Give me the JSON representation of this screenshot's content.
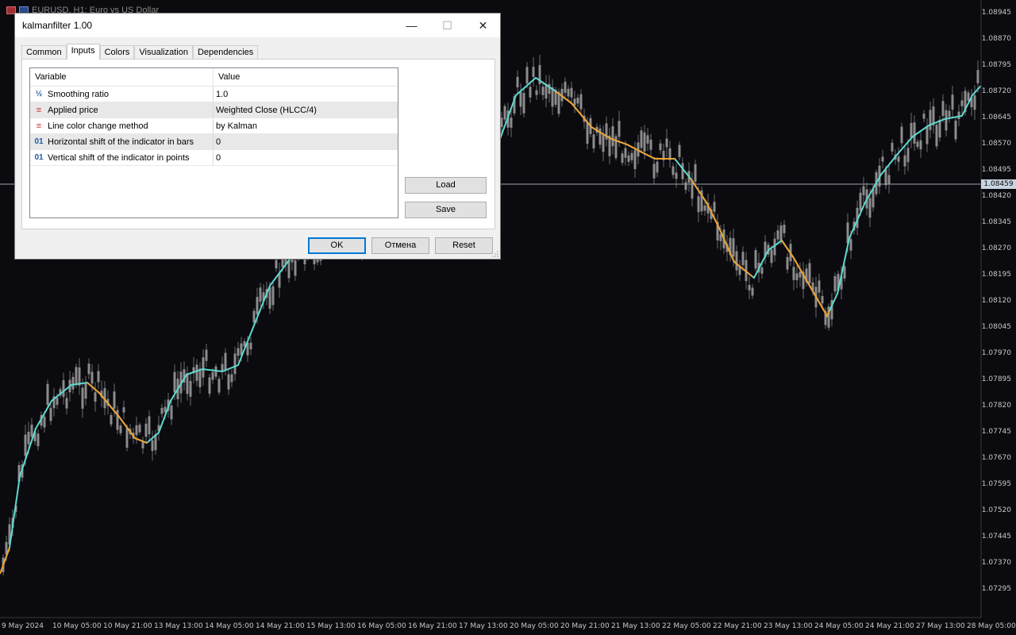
{
  "chart": {
    "title": "EURUSD, H1: Euro vs US Dollar",
    "current_price": "1.08459",
    "price_labels": [
      "1.08945",
      "1.08870",
      "1.08795",
      "1.08720",
      "1.08645",
      "1.08570",
      "1.08495",
      "1.08420",
      "1.08345",
      "1.08270",
      "1.08195",
      "1.08120",
      "1.08045",
      "1.07970",
      "1.07895",
      "1.07820",
      "1.07745",
      "1.07670",
      "1.07595",
      "1.07520",
      "1.07445",
      "1.07370",
      "1.07295"
    ],
    "time_labels": [
      "9 May 2024",
      "10 May 05:00",
      "10 May 21:00",
      "13 May 13:00",
      "14 May 05:00",
      "14 May 21:00",
      "15 May 13:00",
      "16 May 05:00",
      "16 May 21:00",
      "17 May 13:00",
      "20 May 05:00",
      "20 May 21:00",
      "21 May 13:00",
      "22 May 05:00",
      "22 May 21:00",
      "23 May 13:00",
      "24 May 05:00",
      "24 May 21:00",
      "27 May 13:00",
      "28 May 05:00"
    ],
    "colors": {
      "background": "#0a0a0f",
      "bars": "#8c8c8c",
      "kalman_up": "#5fd9d0",
      "kalman_down": "#f0a030",
      "crosshair": "#9aa4b0"
    }
  },
  "dialog": {
    "title": "kalmanfilter 1.00",
    "tabs": [
      {
        "label": "Common"
      },
      {
        "label": "Inputs"
      },
      {
        "label": "Colors"
      },
      {
        "label": "Visualization"
      },
      {
        "label": "Dependencies"
      }
    ],
    "active_tab": "Inputs",
    "grid": {
      "header_variable": "Variable",
      "header_value": "Value",
      "rows": [
        {
          "icon": "fraction-icon",
          "glyph": "½",
          "variable": "Smoothing ratio",
          "value": "1.0"
        },
        {
          "icon": "enum-icon",
          "glyph": "≡",
          "variable": "Applied price",
          "value": "Weighted Close (HLCC/4)"
        },
        {
          "icon": "enum-icon",
          "glyph": "≡",
          "variable": "Line color change method",
          "value": "by Kalman"
        },
        {
          "icon": "integer-icon",
          "glyph": "01",
          "variable": "Horizontal shift of the indicator in bars",
          "value": "0"
        },
        {
          "icon": "integer-icon",
          "glyph": "01",
          "variable": "Vertical shift of the indicator in points",
          "value": "0"
        }
      ]
    },
    "buttons": {
      "load": "Load",
      "save": "Save",
      "ok": "OK",
      "cancel": "Отмена",
      "reset": "Reset"
    },
    "window_controls": {
      "minimize": "—",
      "maximize": "☐",
      "close": "✕"
    }
  }
}
